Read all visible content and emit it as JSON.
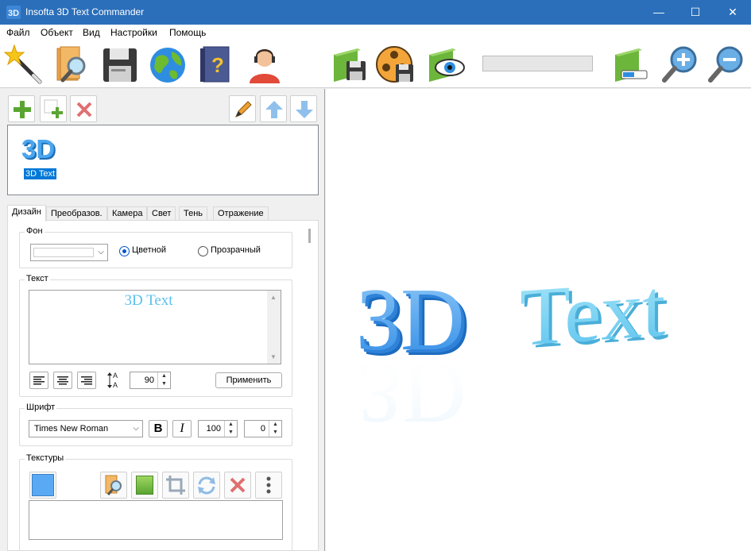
{
  "window": {
    "title": "Insofta 3D Text Commander",
    "minimize": "—",
    "maximize": "☐",
    "close": "✕"
  },
  "menu": {
    "items": [
      "Файл",
      "Объект",
      "Вид",
      "Настройки",
      "Помощь"
    ]
  },
  "toolbar": {
    "icons": [
      "magic-wand-icon",
      "open-search-icon",
      "save-floppy-icon",
      "globe-icon",
      "help-book-icon",
      "support-agent-icon",
      "save-image-icon",
      "save-video-icon",
      "preview-eye-icon",
      "resize-icon",
      "zoom-in-icon",
      "zoom-out-icon"
    ]
  },
  "objects": {
    "logo_text": "3D",
    "items": [
      {
        "label": "3D Text"
      }
    ]
  },
  "tabs": [
    "Дизайн",
    "Преобразов.",
    "Камера",
    "Свет",
    "Тень",
    "Отражение"
  ],
  "design": {
    "background": {
      "title": "Фон",
      "option_colored": "Цветной",
      "option_transparent": "Прозрачный",
      "selected": "Цветной"
    },
    "text": {
      "title": "Текст",
      "value": "3D Text",
      "size": "90",
      "apply_label": "Применить"
    },
    "font": {
      "title": "Шрифт",
      "family": "Times New Roman",
      "bold": "B",
      "italic": "I",
      "width": "100",
      "spacing": "0"
    },
    "textures": {
      "title": "Текстуры",
      "swatch_color": "#5aa9f5"
    }
  },
  "canvas": {
    "text_part1": "3D",
    "text_part2": "Text",
    "color1": "#4aa6ee",
    "color2": "#7fd3f1"
  }
}
